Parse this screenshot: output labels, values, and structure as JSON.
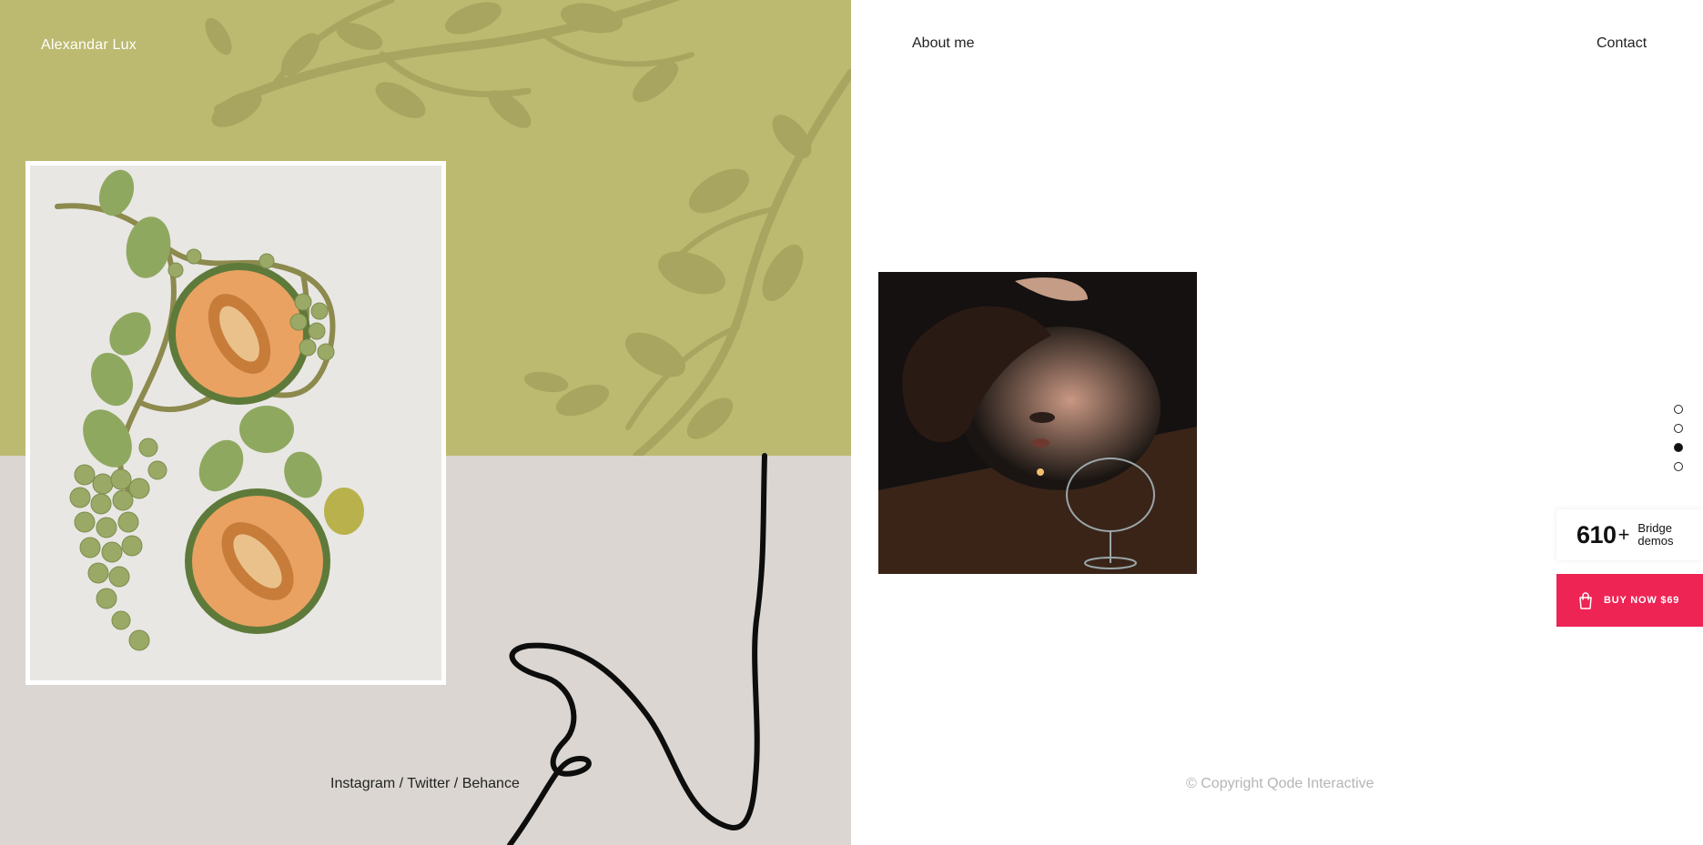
{
  "header": {
    "brand": "Alexandar Lux",
    "nav": {
      "about": "About me",
      "contact": "Contact"
    }
  },
  "footer": {
    "social": {
      "instagram": "Instagram",
      "twitter": "Twitter",
      "behance": "Behance",
      "separator": "/"
    },
    "copyright": "© Copyright Qode Interactive"
  },
  "slider": {
    "dots_count": 4,
    "active_index": 2
  },
  "promo": {
    "demos_count": "610",
    "demos_plus": "+",
    "demos_label": "Bridge demos",
    "buy_label": "BUY NOW $69"
  },
  "colors": {
    "olive_background": "#bcba70",
    "taupe_background": "#dbd6d1",
    "buy_button": "#ee2454",
    "copyright_text": "#b5b5b5"
  },
  "icons": {
    "bag": "shopping-bag-icon"
  }
}
